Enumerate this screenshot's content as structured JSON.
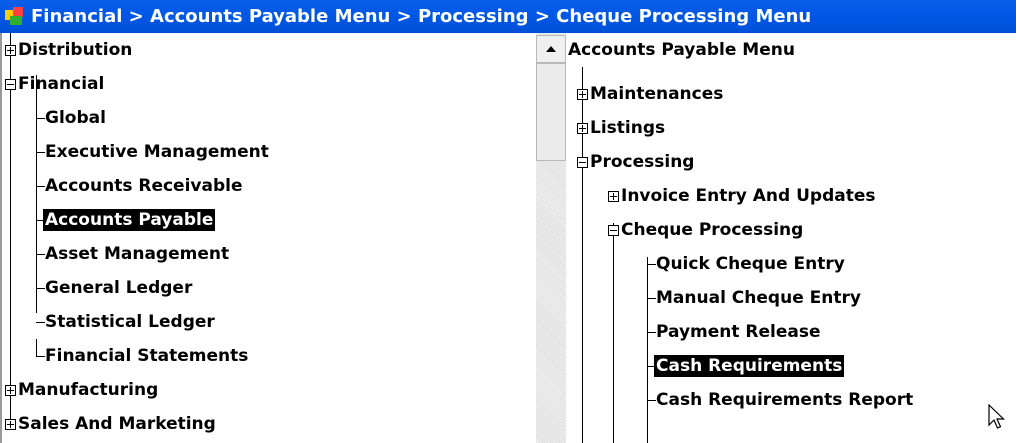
{
  "window": {
    "title": "Financial > Accounts Payable Menu > Processing > Cheque Processing Menu"
  },
  "left_tree": {
    "items": [
      {
        "label": "Distribution",
        "level": 0,
        "expander": "plus"
      },
      {
        "label": "Financial",
        "level": 0,
        "expander": "minus"
      },
      {
        "label": "Global",
        "level": 1
      },
      {
        "label": "Executive Management",
        "level": 1
      },
      {
        "label": "Accounts Receivable",
        "level": 1
      },
      {
        "label": "Accounts Payable",
        "level": 1,
        "selected": true
      },
      {
        "label": "Asset Management",
        "level": 1
      },
      {
        "label": "General Ledger",
        "level": 1
      },
      {
        "label": "Statistical Ledger",
        "level": 1
      },
      {
        "label": "Financial Statements",
        "level": 1
      },
      {
        "label": "Manufacturing",
        "level": 0,
        "expander": "plus"
      },
      {
        "label": "Sales And Marketing",
        "level": 0,
        "expander": "plus"
      }
    ]
  },
  "right_tree": {
    "header": "Accounts Payable Menu",
    "items": [
      {
        "label": "Maintenances",
        "level": 0,
        "expander": "plus"
      },
      {
        "label": "Listings",
        "level": 0,
        "expander": "plus"
      },
      {
        "label": "Processing",
        "level": 0,
        "expander": "minus"
      },
      {
        "label": "Invoice Entry And Updates",
        "level": 1,
        "expander": "plus"
      },
      {
        "label": "Cheque Processing",
        "level": 1,
        "expander": "minus"
      },
      {
        "label": "Quick Cheque Entry",
        "level": 2
      },
      {
        "label": "Manual Cheque Entry",
        "level": 2
      },
      {
        "label": "Payment Release",
        "level": 2
      },
      {
        "label": "Cash Requirements",
        "level": 2,
        "selected": true
      },
      {
        "label": "Cash Requirements Report",
        "level": 2
      }
    ]
  },
  "icons": {
    "app": "app-icon",
    "scroll_up": "scroll-up-arrow-icon",
    "cursor": "mouse-pointer-icon"
  }
}
